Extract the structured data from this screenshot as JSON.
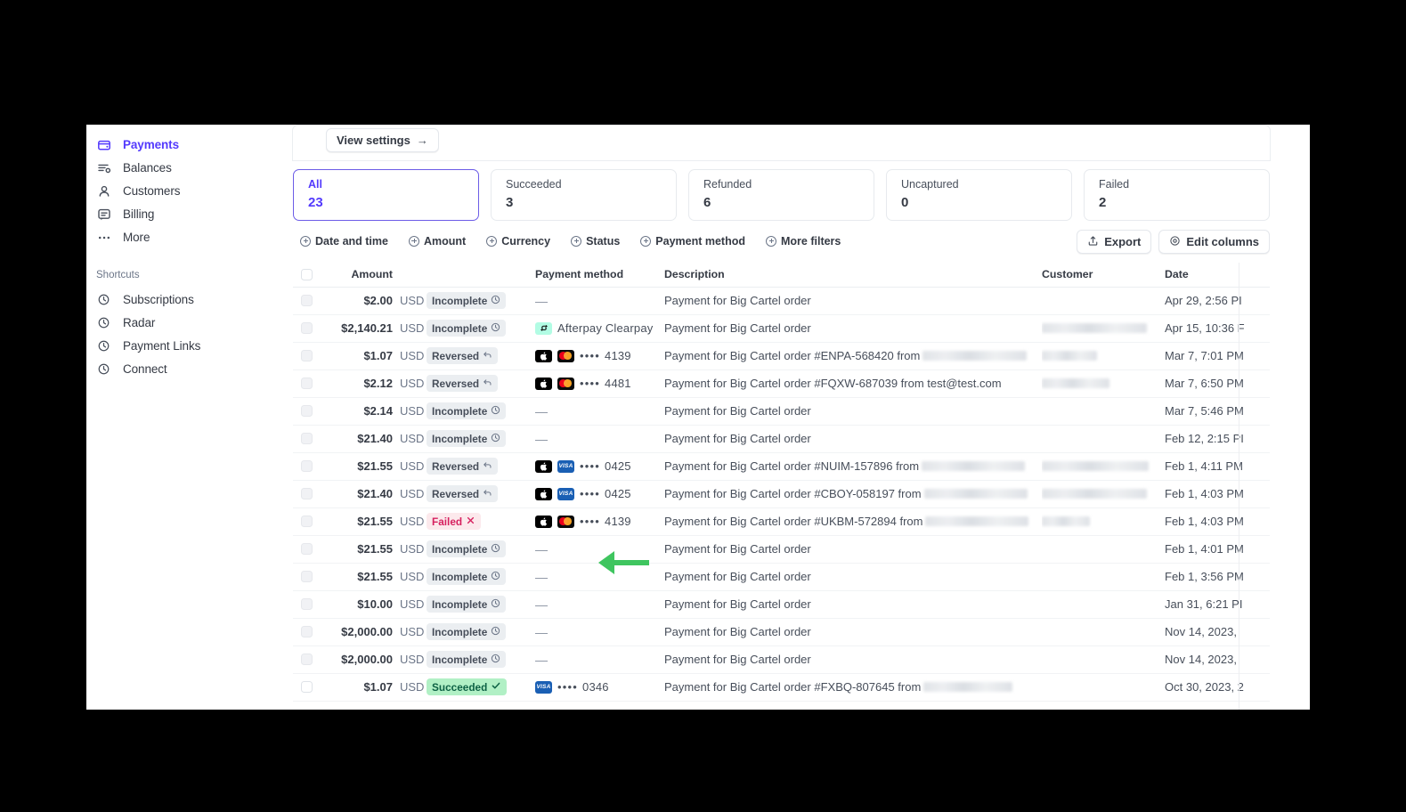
{
  "sidebar": {
    "items": [
      {
        "label": "Payments",
        "icon": "payments-icon",
        "active": true
      },
      {
        "label": "Balances",
        "icon": "balances-icon",
        "active": false
      },
      {
        "label": "Customers",
        "icon": "customers-icon",
        "active": false
      },
      {
        "label": "Billing",
        "icon": "billing-icon",
        "active": false
      },
      {
        "label": "More",
        "icon": "more-icon",
        "active": false
      }
    ],
    "shortcuts_heading": "Shortcuts",
    "shortcuts": [
      {
        "label": "Subscriptions",
        "icon": "clock-icon"
      },
      {
        "label": "Radar",
        "icon": "clock-icon"
      },
      {
        "label": "Payment Links",
        "icon": "clock-icon"
      },
      {
        "label": "Connect",
        "icon": "clock-icon"
      }
    ]
  },
  "toolbar": {
    "view_settings_label": "View settings",
    "view_settings_arrow": "→",
    "export_label": "Export",
    "edit_columns_label": "Edit columns"
  },
  "status_tabs": [
    {
      "label": "All",
      "value": "23",
      "selected": true
    },
    {
      "label": "Succeeded",
      "value": "3",
      "selected": false
    },
    {
      "label": "Refunded",
      "value": "6",
      "selected": false
    },
    {
      "label": "Uncaptured",
      "value": "0",
      "selected": false
    },
    {
      "label": "Failed",
      "value": "2",
      "selected": false
    }
  ],
  "filters": [
    {
      "label": "Date and time"
    },
    {
      "label": "Amount"
    },
    {
      "label": "Currency"
    },
    {
      "label": "Status"
    },
    {
      "label": "Payment method"
    },
    {
      "label": "More filters"
    }
  ],
  "table": {
    "columns": [
      "",
      "Amount",
      "",
      "",
      "Payment method",
      "Description",
      "Customer",
      "Date",
      ""
    ],
    "headers": {
      "amount": "Amount",
      "payment_method": "Payment method",
      "description": "Description",
      "customer": "Customer",
      "date": "Date"
    },
    "row_menu_glyph": "···",
    "em_dash": "—",
    "card_dots": "••••",
    "rows": [
      {
        "amount": "$2.00",
        "currency": "USD",
        "status": "Incomplete",
        "status_kind": "incomplete",
        "pm_kind": "none",
        "pm_brands": [],
        "pm_text": "",
        "description": "Payment for Big Cartel order",
        "desc_redacted": 0,
        "customer_redacted": 0,
        "date": "Apr 29, 2:56 PI"
      },
      {
        "amount": "$2,140.21",
        "currency": "USD",
        "status": "Incomplete",
        "status_kind": "incomplete",
        "pm_kind": "wallet",
        "pm_brands": [
          "afterpay"
        ],
        "pm_text": "Afterpay Clearpay",
        "description": "Payment for Big Cartel order",
        "desc_redacted": 0,
        "customer_redacted": 118,
        "date": "Apr 15, 10:36 F"
      },
      {
        "amount": "$1.07",
        "currency": "USD",
        "status": "Reversed",
        "status_kind": "reversed",
        "pm_kind": "card",
        "pm_brands": [
          "apple",
          "mastercard"
        ],
        "pm_text": "4139",
        "description": "Payment for Big Cartel order #ENPA-568420 from",
        "desc_redacted": 117,
        "customer_redacted": 62,
        "date": "Mar 7, 7:01 PM"
      },
      {
        "amount": "$2.12",
        "currency": "USD",
        "status": "Reversed",
        "status_kind": "reversed",
        "pm_kind": "card",
        "pm_brands": [
          "apple",
          "mastercard"
        ],
        "pm_text": "4481",
        "description": "Payment for Big Cartel order #FQXW-687039 from test@test.com",
        "desc_redacted": 0,
        "customer_redacted": 76,
        "date": "Mar 7, 6:50 PM"
      },
      {
        "amount": "$2.14",
        "currency": "USD",
        "status": "Incomplete",
        "status_kind": "incomplete",
        "pm_kind": "none",
        "pm_brands": [],
        "pm_text": "",
        "description": "Payment for Big Cartel order",
        "desc_redacted": 0,
        "customer_redacted": 0,
        "date": "Mar 7, 5:46 PM"
      },
      {
        "amount": "$21.40",
        "currency": "USD",
        "status": "Incomplete",
        "status_kind": "incomplete",
        "pm_kind": "none",
        "pm_brands": [],
        "pm_text": "",
        "description": "Payment for Big Cartel order",
        "desc_redacted": 0,
        "customer_redacted": 0,
        "date": "Feb 12, 2:15 PI"
      },
      {
        "amount": "$21.55",
        "currency": "USD",
        "status": "Reversed",
        "status_kind": "reversed",
        "pm_kind": "card",
        "pm_brands": [
          "apple",
          "visa"
        ],
        "pm_text": "0425",
        "description": "Payment for Big Cartel order #NUIM-157896 from",
        "desc_redacted": 116,
        "customer_redacted": 120,
        "date": "Feb 1, 4:11 PM"
      },
      {
        "amount": "$21.40",
        "currency": "USD",
        "status": "Reversed",
        "status_kind": "reversed",
        "pm_kind": "card",
        "pm_brands": [
          "apple",
          "visa"
        ],
        "pm_text": "0425",
        "description": "Payment for Big Cartel order #CBOY-058197 from",
        "desc_redacted": 116,
        "customer_redacted": 118,
        "date": "Feb 1, 4:03 PM"
      },
      {
        "amount": "$21.55",
        "currency": "USD",
        "status": "Failed",
        "status_kind": "failed",
        "pm_kind": "card",
        "pm_brands": [
          "apple",
          "mastercard"
        ],
        "pm_text": "4139",
        "description": "Payment for Big Cartel order #UKBM-572894 from",
        "desc_redacted": 116,
        "customer_redacted": 54,
        "date": "Feb 1, 4:03 PM"
      },
      {
        "amount": "$21.55",
        "currency": "USD",
        "status": "Incomplete",
        "status_kind": "incomplete",
        "pm_kind": "none",
        "pm_brands": [],
        "pm_text": "",
        "description": "Payment for Big Cartel order",
        "desc_redacted": 0,
        "customer_redacted": 0,
        "date": "Feb 1, 4:01 PM"
      },
      {
        "amount": "$21.55",
        "currency": "USD",
        "status": "Incomplete",
        "status_kind": "incomplete",
        "pm_kind": "none",
        "pm_brands": [],
        "pm_text": "",
        "description": "Payment for Big Cartel order",
        "desc_redacted": 0,
        "customer_redacted": 0,
        "date": "Feb 1, 3:56 PM"
      },
      {
        "amount": "$10.00",
        "currency": "USD",
        "status": "Incomplete",
        "status_kind": "incomplete",
        "pm_kind": "none",
        "pm_brands": [],
        "pm_text": "",
        "description": "Payment for Big Cartel order",
        "desc_redacted": 0,
        "customer_redacted": 0,
        "date": "Jan 31, 6:21 PI"
      },
      {
        "amount": "$2,000.00",
        "currency": "USD",
        "status": "Incomplete",
        "status_kind": "incomplete",
        "pm_kind": "none",
        "pm_brands": [],
        "pm_text": "",
        "description": "Payment for Big Cartel order",
        "desc_redacted": 0,
        "customer_redacted": 0,
        "date": "Nov 14, 2023,"
      },
      {
        "amount": "$2,000.00",
        "currency": "USD",
        "status": "Incomplete",
        "status_kind": "incomplete",
        "pm_kind": "none",
        "pm_brands": [],
        "pm_text": "",
        "description": "Payment for Big Cartel order",
        "desc_redacted": 0,
        "customer_redacted": 0,
        "date": "Nov 14, 2023,"
      },
      {
        "amount": "$1.07",
        "currency": "USD",
        "status": "Succeeded",
        "status_kind": "succeeded",
        "pm_kind": "card",
        "pm_brands": [
          "visa"
        ],
        "pm_text": "0346",
        "description": "Payment for Big Cartel order #FXBQ-807645 from",
        "desc_redacted": 100,
        "customer_redacted": 0,
        "date": "Oct 30, 2023, 2"
      }
    ]
  },
  "annotation": {
    "arrow_color": "#3fc55f",
    "arrow_direction": "left",
    "points_at": "payment-method-cell-row-6"
  },
  "colors": {
    "brand_purple": "#533afd",
    "text_primary": "#353a44",
    "text_secondary": "#6c7688",
    "border": "#ebeef1",
    "success_bg": "#b1f0c5",
    "success_fg": "#0e6245",
    "fail_bg": "#fce9ec",
    "fail_fg": "#d6215f"
  }
}
